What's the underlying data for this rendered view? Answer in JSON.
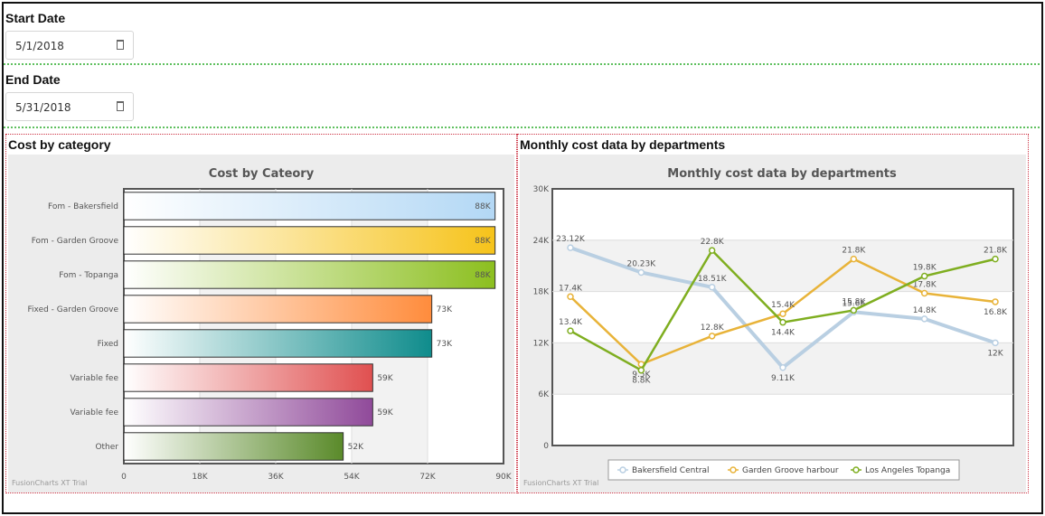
{
  "start_date": {
    "label": "Start Date",
    "value": "5/1/2018"
  },
  "end_date": {
    "label": "End Date",
    "value": "5/31/2018"
  },
  "panels": {
    "left_title": "Cost by category",
    "right_title": "Monthly cost data by departments",
    "trial_text": "FusionCharts XT Trial"
  },
  "chart_data": [
    {
      "type": "bar",
      "orientation": "horizontal",
      "title": "Cost by Cateory",
      "categories": [
        "Fom - Bakersfield",
        "Fom - Garden Groove",
        "Fom - Topanga",
        "Fixed - Garden Groove",
        "Fixed",
        "Variable fee",
        "Variable fee",
        "Other"
      ],
      "values": [
        88000,
        88000,
        88000,
        73000,
        73000,
        59000,
        59000,
        52000
      ],
      "value_labels": [
        "88K",
        "88K",
        "88K",
        "73K",
        "73K",
        "59K",
        "59K",
        "52K"
      ],
      "colors": [
        "#b3d8f5",
        "#f6c31a",
        "#8cbf1f",
        "#ff8c3c",
        "#0f8c8c",
        "#e05050",
        "#904a9a",
        "#5a8a2a"
      ],
      "xlim": [
        0,
        90000
      ],
      "x_ticks": [
        "0",
        "18K",
        "36K",
        "54K",
        "72K",
        "90K"
      ]
    },
    {
      "type": "line",
      "title": "Monthly cost data by departments",
      "ylim": [
        0,
        30000
      ],
      "y_ticks": [
        "0",
        "6K",
        "12K",
        "18K",
        "24K",
        "30K"
      ],
      "series": [
        {
          "name": "Bakersfield Central",
          "color": "#b9cfe2",
          "values": [
            23120,
            20230,
            18510,
            9110,
            15600,
            14800,
            12000
          ],
          "labels": [
            "23.12K",
            "20.23K",
            "18.51K",
            "9.11K",
            "15.6K",
            "14.8K",
            "12K"
          ]
        },
        {
          "name": "Garden Groove harbour",
          "color": "#e8b339",
          "values": [
            17400,
            9500,
            12800,
            15400,
            21800,
            17800,
            16800
          ],
          "labels": [
            "17.4K",
            "9.5K",
            "12.8K",
            "15.4K",
            "21.8K",
            "17.8K",
            "16.8K"
          ]
        },
        {
          "name": "Los Angeles Topanga",
          "color": "#7fae20",
          "values": [
            13400,
            8800,
            22800,
            14400,
            15800,
            19800,
            21800
          ],
          "labels": [
            "13.4K",
            "8.8K",
            "22.8K",
            "14.4K",
            "15.8K",
            "19.8K",
            "21.8K"
          ]
        }
      ]
    }
  ]
}
